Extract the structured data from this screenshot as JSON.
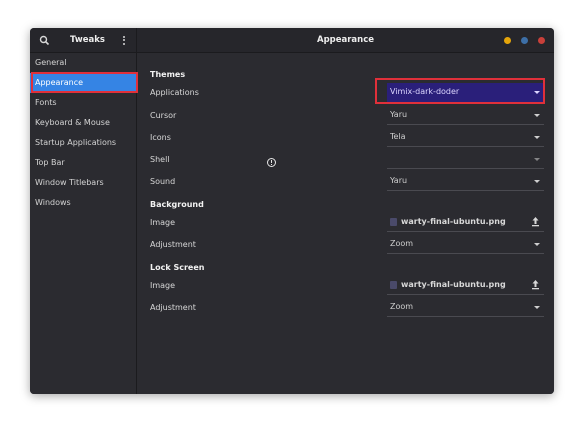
{
  "header": {
    "app_title": "Tweaks",
    "page_title": "Appearance",
    "window_controls": {
      "minimize_color": "#e5a50a",
      "maximize_color": "#3d6fa7",
      "close_color": "#c9403a"
    }
  },
  "sidebar": {
    "items": [
      {
        "label": "General"
      },
      {
        "label": "Appearance",
        "selected": true
      },
      {
        "label": "Fonts"
      },
      {
        "label": "Keyboard & Mouse"
      },
      {
        "label": "Startup Applications"
      },
      {
        "label": "Top Bar"
      },
      {
        "label": "Window Titlebars"
      },
      {
        "label": "Windows"
      }
    ],
    "accent_color": "#3584e4"
  },
  "themes": {
    "title": "Themes",
    "applications": {
      "label": "Applications",
      "value": "Vimix-dark-doder"
    },
    "cursor": {
      "label": "Cursor",
      "value": "Yaru"
    },
    "icons": {
      "label": "Icons",
      "value": "Tela"
    },
    "shell": {
      "label": "Shell",
      "value": ""
    },
    "sound": {
      "label": "Sound",
      "value": "Yaru"
    }
  },
  "background": {
    "title": "Background",
    "image": {
      "label": "Image",
      "value": "warty-final-ubuntu.png"
    },
    "adjustment": {
      "label": "Adjustment",
      "value": "Zoom"
    }
  },
  "lock_screen": {
    "title": "Lock Screen",
    "image": {
      "label": "Image",
      "value": "warty-final-ubuntu.png"
    },
    "adjustment": {
      "label": "Adjustment",
      "value": "Zoom"
    }
  },
  "highlight_color": "#e0303a"
}
